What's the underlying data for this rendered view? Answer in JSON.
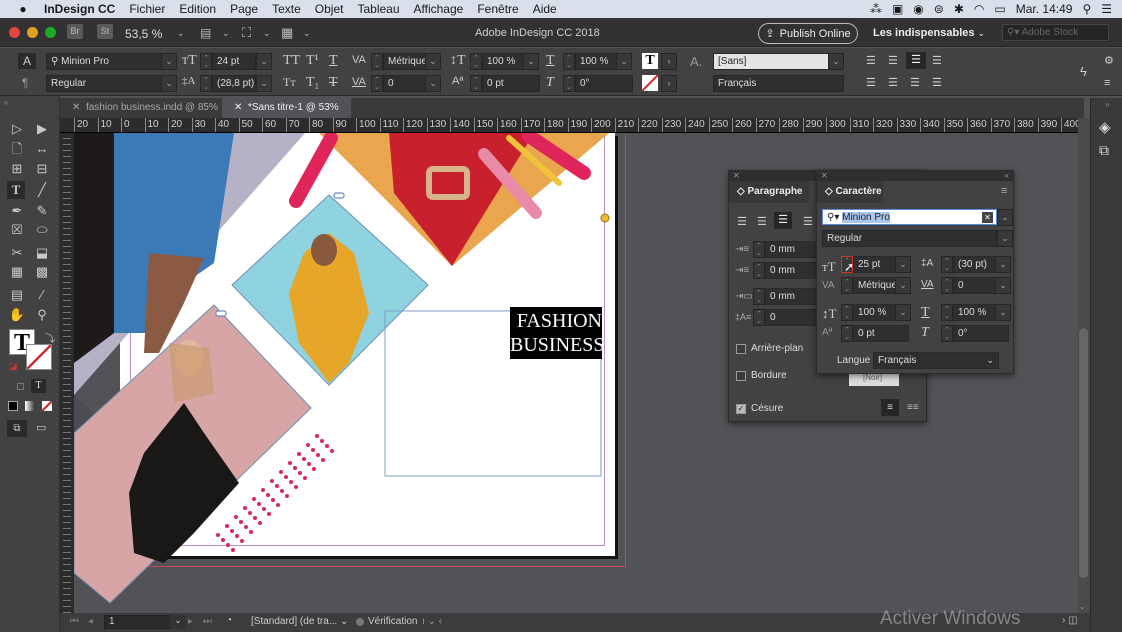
{
  "menubar": {
    "app": "InDesign CC",
    "items": [
      "Fichier",
      "Edition",
      "Page",
      "Texte",
      "Objet",
      "Tableau",
      "Affichage",
      "Fenêtre",
      "Aide"
    ],
    "clock": "Mar. 14:49"
  },
  "appbar": {
    "bridge": "Br",
    "stock": "St",
    "zoom": "53,5 %",
    "title": "Adobe InDesign CC 2018",
    "publish": "Publish Online",
    "workspace": "Les indispensables",
    "search_placeholder": "Adobe Stock"
  },
  "control": {
    "font": "Minion Pro",
    "style": "Regular",
    "size": "24 pt",
    "leading": "(28,8 pt)",
    "kerning": "Métrique",
    "tracking": "0",
    "vscale": "100 %",
    "hscale": "100 %",
    "baseline": "0 pt",
    "skew": "0°",
    "charstyle": "[Sans]",
    "language": "Français"
  },
  "tabs": [
    {
      "label": "fashion business.indd @ 85%",
      "active": false
    },
    {
      "label": "*Sans titre-1 @ 53%",
      "active": true
    }
  ],
  "ruler": {
    "h": [
      "20",
      "10",
      "0",
      "10",
      "20",
      "30",
      "40",
      "50",
      "60",
      "70",
      "80",
      "90",
      "100",
      "110",
      "120",
      "130",
      "140",
      "150",
      "160",
      "170",
      "180",
      "190",
      "200",
      "210",
      "220",
      "230",
      "240",
      "250",
      "260",
      "270",
      "280",
      "290",
      "300",
      "310",
      "320",
      "330",
      "340",
      "350",
      "360",
      "370",
      "380",
      "390",
      "400"
    ]
  },
  "document": {
    "headline1": "FASHION",
    "headline2": "BUSINESS"
  },
  "paragraph_panel": {
    "title": "Paragraphe",
    "left_indent": "0 mm",
    "first_indent": "0 mm",
    "space_before": "0 mm",
    "dropcap": "0",
    "shading": "Arrière-plan",
    "border": "Bordure",
    "hyphenate": "Césure",
    "hyphenate_checked": true
  },
  "character_panel": {
    "title": "Caractère",
    "font": "Minion Pro",
    "style": "Regular",
    "size": "25 pt",
    "leading": "(30 pt)",
    "kerning": "Métrique",
    "tracking": "0",
    "vscale": "100 %",
    "hscale": "100 %",
    "baseline": "0 pt",
    "skew": "0°",
    "language_label": "Langue :",
    "language": "Français",
    "swatch": "[Noir]"
  },
  "statusbar": {
    "page": "1",
    "preflight_profile": "[Standard] (de tra...",
    "preflight": "Vérification"
  },
  "watermark": "Activer Windows"
}
